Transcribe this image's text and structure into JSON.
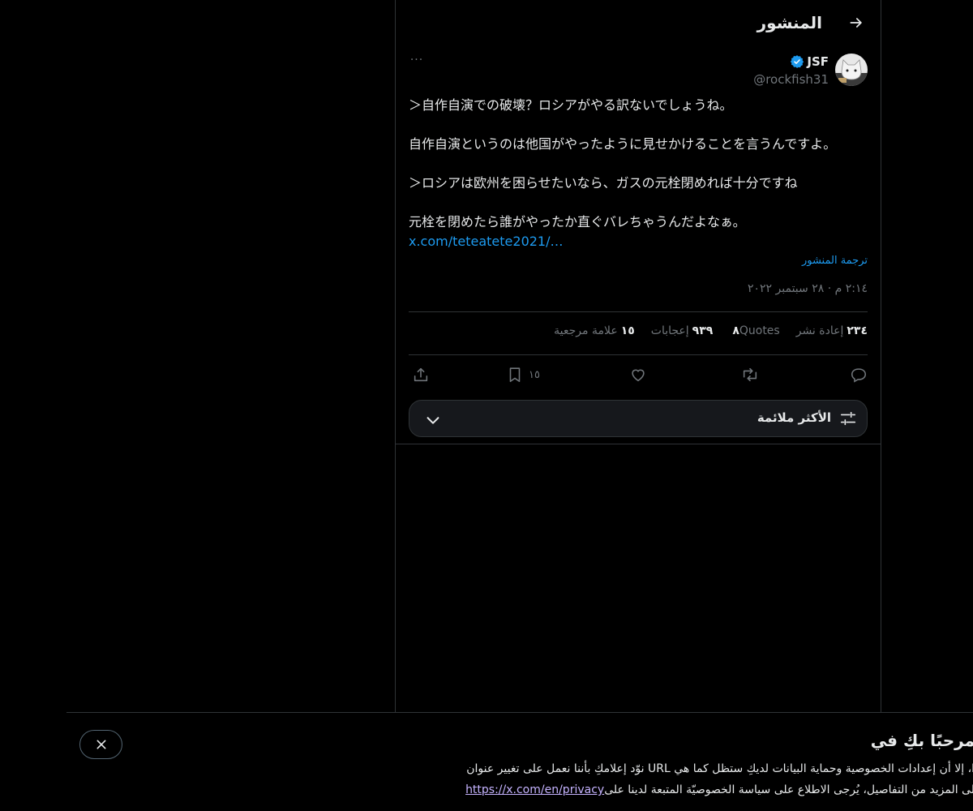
{
  "header": {
    "title": "المنشور",
    "back_icon": "arrow-right-icon"
  },
  "author": {
    "display_name": "JSF",
    "handle": "@rockfish31",
    "verified": true,
    "verified_color": "#1d9bf0",
    "more_label": "···"
  },
  "post": {
    "lines": [
      "＞自作自演での破壊？ロシアがやる訳ないでしょうね。",
      "自作自演というのは他国がやったように見せかけることを言うんですよ。",
      "＞ロシアは欧州を困らせたいなら、ガスの元栓閉めれば十分ですね",
      "元栓を閉めたら誰がやったか直ぐバレちゃうんだよなぁ。"
    ],
    "link": "x.com/teteatete2021/…",
    "translate": "ترجمة المنشور",
    "timestamp": "٢:١٤ م · ٢٨ سبتمبر ٢٠٢٢"
  },
  "stats": [
    {
      "value": "٢٣٤",
      "label": "إعادة نشر"
    },
    {
      "value": "٨",
      "label": "Quotes"
    },
    {
      "value": "٩٣٩",
      "label": "إعجابات"
    },
    {
      "value": "١٥",
      "label": "علامة مرجعية"
    }
  ],
  "actions": {
    "bookmark_count": "١٥"
  },
  "sort": {
    "label": "الأكثر ملائمة"
  },
  "banner": {
    "title": "مرحبًا بكِ في",
    "line1": "ا، إلا أن إعدادات الخصوصية وحماية البيانات لديكِ ستظل كما هي URL نوّد إعلامكِ بأننا نعمل على تغيير عنوان",
    "line2_text": "لى المزيد من التفاصيل، يُرجى الاطلاع على سياسة الخصوصيّة المتبعة لدينا على",
    "line2_link": "https://x.com/en/privacy"
  },
  "colors": {
    "accent": "#1d9bf0",
    "background": "#000000",
    "muted": "#71767b",
    "border": "#2f3336"
  }
}
